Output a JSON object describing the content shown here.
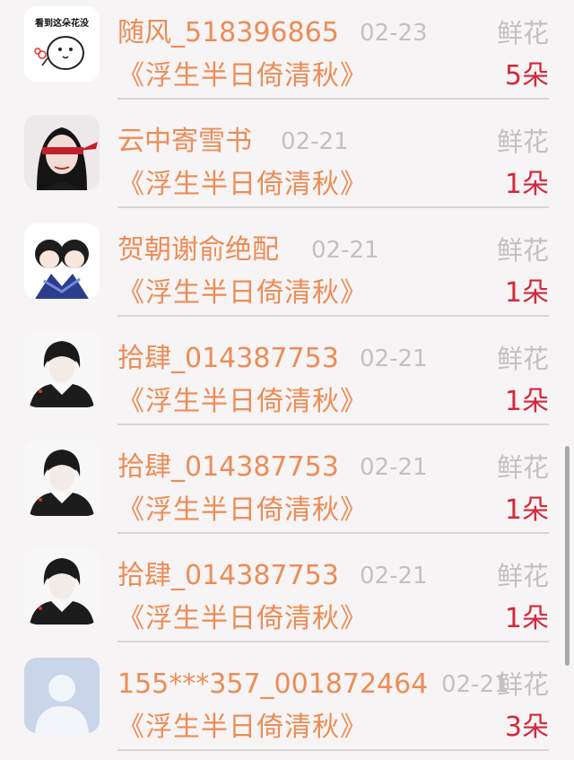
{
  "records": [
    {
      "name": "随风_518396865",
      "date": "02-23",
      "gift": "鲜花",
      "book": "《浮生半日倚清秋》",
      "count": "5朵",
      "avatar_icon": "meme-flower-icon",
      "avatar_caption": "看到这朵花没"
    },
    {
      "name": "云中寄雪书",
      "date": "02-21",
      "gift": "鲜花",
      "book": "《浮生半日倚清秋》",
      "count": "1朵",
      "avatar_icon": "girl-blindfold-avatar-icon"
    },
    {
      "name": "贺朝谢俞绝配",
      "date": "02-21",
      "gift": "鲜花",
      "book": "《浮生半日倚清秋》",
      "count": "1朵",
      "avatar_icon": "two-boys-avatar-icon"
    },
    {
      "name": "拾肆_014387753",
      "date": "02-21",
      "gift": "鲜花",
      "book": "《浮生半日倚清秋》",
      "count": "1朵",
      "avatar_icon": "boy-suit-avatar-icon"
    },
    {
      "name": "拾肆_014387753",
      "date": "02-21",
      "gift": "鲜花",
      "book": "《浮生半日倚清秋》",
      "count": "1朵",
      "avatar_icon": "boy-suit-avatar-icon"
    },
    {
      "name": "拾肆_014387753",
      "date": "02-21",
      "gift": "鲜花",
      "book": "《浮生半日倚清秋》",
      "count": "1朵",
      "avatar_icon": "boy-suit-avatar-icon"
    },
    {
      "name": "155***357_001872464",
      "date": "02-21",
      "gift": "鲜花",
      "book": "《浮生半日倚清秋》",
      "count": "3朵",
      "avatar_icon": "default-user-avatar-icon"
    }
  ],
  "colors": {
    "name": "#ec8c57",
    "date": "#c4c0c0",
    "gift": "#c4c0c0",
    "count": "#d3283c",
    "divider": "#d9d5d5",
    "background": "#f6f4f4"
  }
}
